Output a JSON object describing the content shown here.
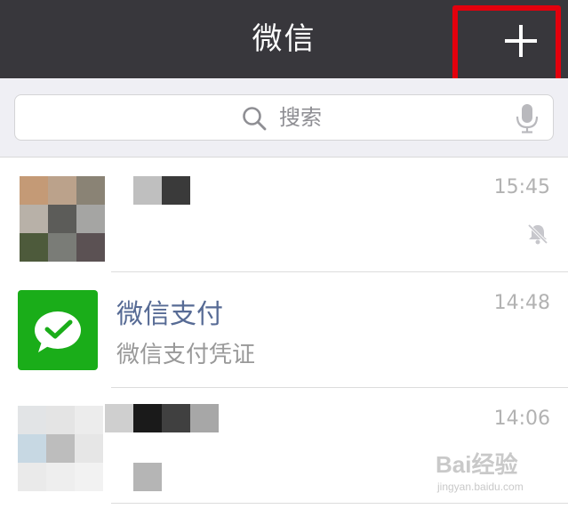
{
  "header": {
    "title": "微信"
  },
  "search": {
    "placeholder": "搜索"
  },
  "chats": [
    {
      "title": "",
      "preview": "",
      "time": "15:45",
      "muted": true
    },
    {
      "title": "微信支付",
      "preview": "微信支付凭证",
      "time": "14:48",
      "muted": false
    },
    {
      "title": "",
      "preview": "",
      "time": "14:06",
      "muted": false
    }
  ],
  "watermark": {
    "brand": "Bai经验",
    "url": "jingyan.baidu.com"
  },
  "colors": {
    "header_bg": "#38373c",
    "annotation_red": "#e3000d",
    "wechat_pay_green": "#1aad19",
    "chat_title_blue": "#576b95"
  },
  "icons": [
    "plus-icon",
    "search-icon",
    "microphone-icon",
    "mute-bell-icon",
    "wechat-pay-icon"
  ]
}
